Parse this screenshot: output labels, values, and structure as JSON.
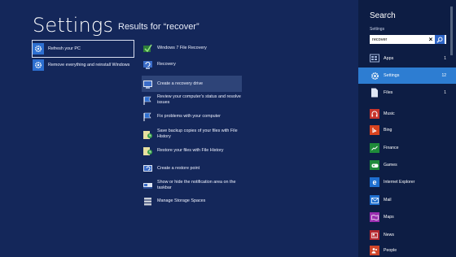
{
  "header": {
    "title": "Settings",
    "results_for": "Results for “recover”"
  },
  "results_col1": [
    {
      "label": "Refresh your PC",
      "icon": "gear-icon"
    },
    {
      "label": "Remove everything and reinstall Windows",
      "icon": "gear-icon"
    }
  ],
  "results_col2": [
    {
      "label": "Windows 7 File Recovery",
      "icon": "file-recovery-icon"
    },
    {
      "label": "Recovery",
      "icon": "recovery-icon"
    },
    {
      "label": "Create a recovery drive",
      "icon": "recovery-drive-icon"
    },
    {
      "label": "Review your computer’s status and resolve issues",
      "icon": "action-center-flag-icon"
    },
    {
      "label": "Fix problems with your computer",
      "icon": "action-center-flag-icon"
    },
    {
      "label": "Save backup copies of your files with File History",
      "icon": "file-history-icon"
    },
    {
      "label": "Restore your files with File History",
      "icon": "file-history-icon"
    },
    {
      "label": "Create a restore point",
      "icon": "system-restore-icon"
    },
    {
      "label": "Show or hide the notification area on the taskbar",
      "icon": "taskbar-icon"
    },
    {
      "label": "Manage Storage Spaces",
      "icon": "storage-spaces-icon"
    }
  ],
  "search_pane": {
    "title": "Search",
    "scope": "Settings",
    "query": "recover",
    "scopes": [
      {
        "label": "Apps",
        "count": "1",
        "icon": "apps-icon"
      },
      {
        "label": "Settings",
        "count": "12",
        "icon": "gear-icon"
      },
      {
        "label": "Files",
        "count": "1",
        "icon": "files-icon"
      }
    ],
    "apps": [
      {
        "label": "Music",
        "color": "#c8342b",
        "icon": "headphones-icon"
      },
      {
        "label": "Bing",
        "color": "#d8431f",
        "icon": "bing-icon"
      },
      {
        "label": "Finance",
        "color": "#1f8a3a",
        "icon": "finance-chart-icon"
      },
      {
        "label": "Games",
        "color": "#1f8a3a",
        "icon": "gamepad-icon"
      },
      {
        "label": "Internet Explorer",
        "color": "#1f6fcf",
        "icon": "ie-icon"
      },
      {
        "label": "Mail",
        "color": "#1f6fcf",
        "icon": "mail-icon"
      },
      {
        "label": "Maps",
        "color": "#9a2fb0",
        "icon": "maps-icon"
      },
      {
        "label": "News",
        "color": "#b5272f",
        "icon": "news-icon"
      },
      {
        "label": "People",
        "color": "#d0462a",
        "icon": "people-icon"
      }
    ]
  },
  "colors": {
    "background": "#14275a",
    "pane": "#0d1d44",
    "accent": "#2d7dd2"
  }
}
